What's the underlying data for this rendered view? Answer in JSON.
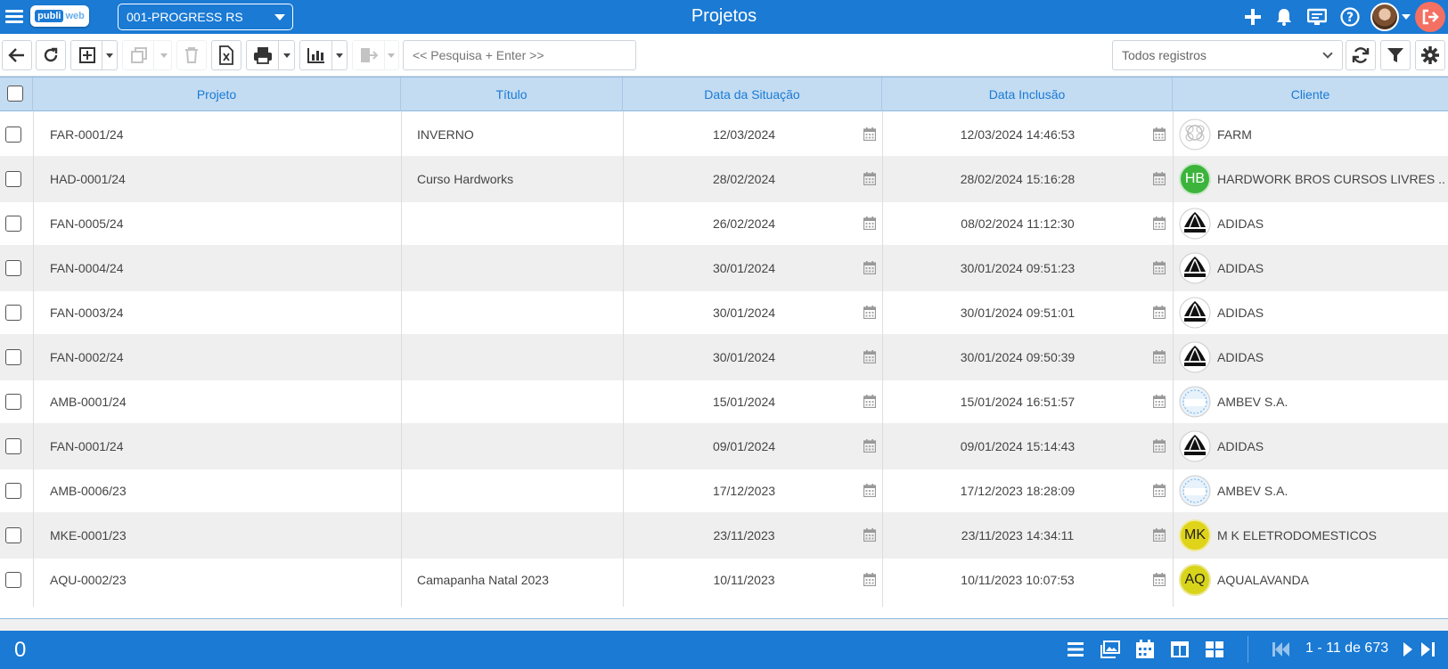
{
  "header": {
    "title": "Projetos",
    "company_select": "001-PROGRESS RS",
    "logo_part1": "publi",
    "logo_part2": "web",
    "icons": [
      "menu-icon",
      "plus-icon",
      "bell-icon",
      "monitor-icon",
      "help-icon",
      "avatar",
      "logout-icon"
    ]
  },
  "toolbar": {
    "search_placeholder": "<< Pesquisa + Enter >>",
    "filter_select": "Todos registros",
    "icons": [
      "back-icon",
      "refresh-icon",
      "add-icon",
      "copy-icon",
      "delete-icon",
      "excel-icon",
      "print-icon",
      "chart-icon",
      "export-icon",
      "sync-icon",
      "filter-icon",
      "settings-icon"
    ]
  },
  "table": {
    "columns": [
      "Projeto",
      "Título",
      "Data da Situação",
      "Data Inclusão",
      "Cliente"
    ],
    "rows": [
      {
        "projeto": "FAR-0001/24",
        "titulo": "INVERNO",
        "data_situacao": "12/03/2024",
        "data_inclusao": "12/03/2024 14:46:53",
        "cliente": "FARM",
        "logo": "farm"
      },
      {
        "projeto": "HAD-0001/24",
        "titulo": "Curso Hardworks",
        "data_situacao": "28/02/2024",
        "data_inclusao": "28/02/2024 15:16:28",
        "cliente": "HARDWORK BROS CURSOS LIVRES ...",
        "logo": "HB"
      },
      {
        "projeto": "FAN-0005/24",
        "titulo": "",
        "data_situacao": "26/02/2024",
        "data_inclusao": "08/02/2024 11:12:30",
        "cliente": "ADIDAS",
        "logo": "adidas"
      },
      {
        "projeto": "FAN-0004/24",
        "titulo": "",
        "data_situacao": "30/01/2024",
        "data_inclusao": "30/01/2024 09:51:23",
        "cliente": "ADIDAS",
        "logo": "adidas"
      },
      {
        "projeto": "FAN-0003/24",
        "titulo": "",
        "data_situacao": "30/01/2024",
        "data_inclusao": "30/01/2024 09:51:01",
        "cliente": "ADIDAS",
        "logo": "adidas"
      },
      {
        "projeto": "FAN-0002/24",
        "titulo": "",
        "data_situacao": "30/01/2024",
        "data_inclusao": "30/01/2024 09:50:39",
        "cliente": "ADIDAS",
        "logo": "adidas"
      },
      {
        "projeto": "AMB-0001/24",
        "titulo": "",
        "data_situacao": "15/01/2024",
        "data_inclusao": "15/01/2024 16:51:57",
        "cliente": "AMBEV S.A.",
        "logo": "ama"
      },
      {
        "projeto": "FAN-0001/24",
        "titulo": "",
        "data_situacao": "09/01/2024",
        "data_inclusao": "09/01/2024 15:14:43",
        "cliente": "ADIDAS",
        "logo": "adidas"
      },
      {
        "projeto": "AMB-0006/23",
        "titulo": "",
        "data_situacao": "17/12/2023",
        "data_inclusao": "17/12/2023 18:28:09",
        "cliente": "AMBEV S.A.",
        "logo": "ama"
      },
      {
        "projeto": "MKE-0001/23",
        "titulo": "",
        "data_situacao": "23/11/2023",
        "data_inclusao": "23/11/2023 14:34:11",
        "cliente": "M K ELETRODOMESTICOS",
        "logo": "MK"
      },
      {
        "projeto": "AQU-0002/23",
        "titulo": "Camapanha Natal 2023",
        "data_situacao": "10/11/2023",
        "data_inclusao": "10/11/2023 10:07:53",
        "cliente": "AQUALAVANDA",
        "logo": "AQ"
      }
    ]
  },
  "footer": {
    "selected_count": "0",
    "pagination": "1 - 11 de 673",
    "view_icons": [
      "list-view-icon",
      "gallery-view-icon",
      "calendar-view-icon",
      "split-view-icon",
      "grid-view-icon"
    ]
  },
  "colors": {
    "primary": "#1a7ad4",
    "header_row": "#c3dcf2",
    "alt_row": "#efefef",
    "logout": "#f47063"
  }
}
